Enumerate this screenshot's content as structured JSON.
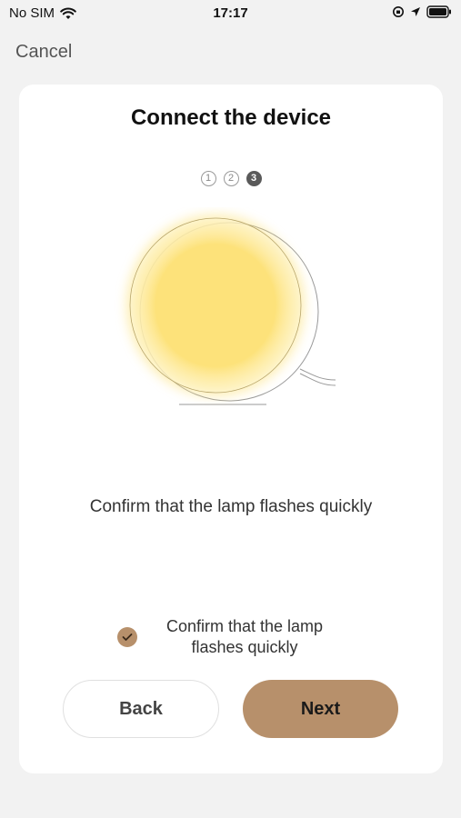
{
  "status_bar": {
    "carrier": "No SIM",
    "time": "17:17"
  },
  "nav": {
    "cancel_label": "Cancel"
  },
  "card": {
    "title": "Connect the device",
    "steps": [
      "1",
      "2",
      "3"
    ],
    "active_step": 3,
    "instruction": "Confirm that the lamp flashes quickly",
    "confirm_checkbox": {
      "label": "Confirm that the lamp flashes quickly",
      "checked": true
    },
    "back_label": "Back",
    "next_label": "Next"
  },
  "colors": {
    "accent": "#b7906b",
    "lamp_glow": "#fde27a",
    "background": "#f2f2f2",
    "card": "#ffffff"
  }
}
